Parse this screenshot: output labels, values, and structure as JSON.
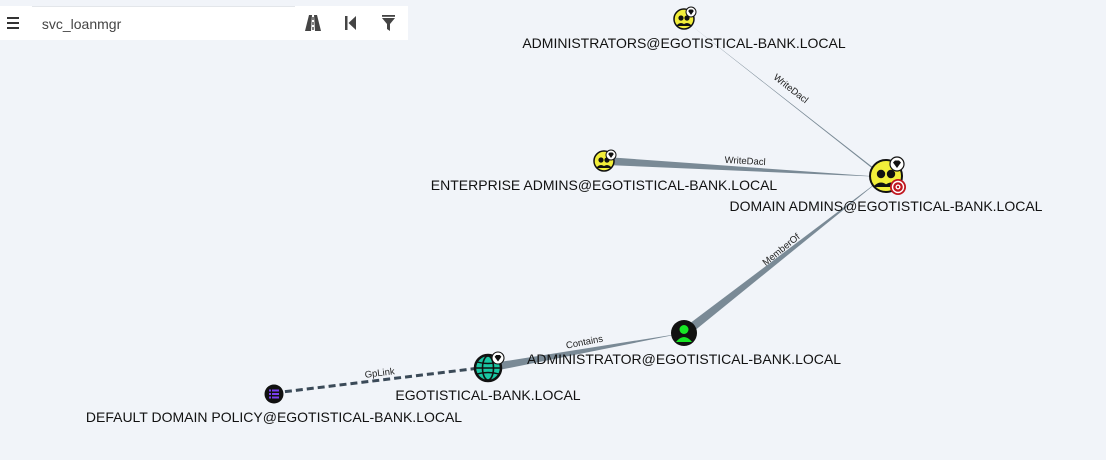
{
  "toolbar": {
    "search_value": "svc_loanmgr",
    "menu_icon": "hamburger-menu-icon",
    "pathfinding_icon": "road-icon",
    "back_icon": "skip-back-icon",
    "filter_icon": "filter-icon"
  },
  "colors": {
    "background": "#f1f4f9",
    "group_node": "#f2ee3a",
    "user_node": "#17e625",
    "domain_node": "#19c7a3",
    "gpo_node": "#7b3ff2",
    "target_badge": "#c0161f",
    "edge": "#7a8a96",
    "gplink_edge": "#3b4a58"
  },
  "nodes": {
    "administrators": {
      "label": "ADMINISTRATORS@EGOTISTICAL-BANK.LOCAL",
      "icon": "group-icon"
    },
    "enterprise_admins": {
      "label": "ENTERPRISE ADMINS@EGOTISTICAL-BANK.LOCAL",
      "icon": "group-icon"
    },
    "domain_admins": {
      "label": "DOMAIN ADMINS@EGOTISTICAL-BANK.LOCAL",
      "icon": "group-icon",
      "badge": "target-icon"
    },
    "administrator": {
      "label": "ADMINISTRATOR@EGOTISTICAL-BANK.LOCAL",
      "icon": "user-icon"
    },
    "domain": {
      "label": "EGOTISTICAL-BANK.LOCAL",
      "icon": "globe-icon"
    },
    "gpo": {
      "label": "DEFAULT DOMAIN POLICY@EGOTISTICAL-BANK.LOCAL",
      "icon": "list-icon"
    }
  },
  "edges": {
    "admins_to_da": "WriteDacl",
    "ea_to_da": "WriteDacl",
    "admin_memberof_da": "MemberOf",
    "domain_contains_admin": "Contains",
    "gpo_gplink_domain": "GpLink"
  }
}
